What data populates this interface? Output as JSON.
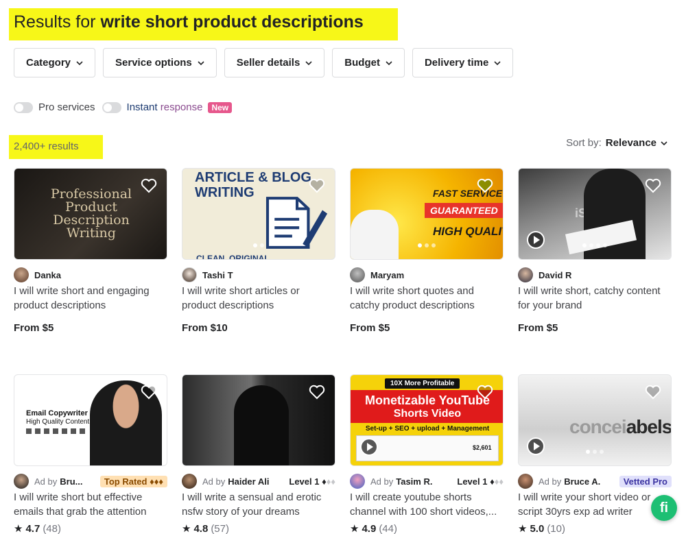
{
  "header": {
    "title_prefix": "Results for ",
    "title_query": "write short product descriptions"
  },
  "filters": [
    {
      "label": "Category"
    },
    {
      "label": "Service options"
    },
    {
      "label": "Seller details"
    },
    {
      "label": "Budget"
    },
    {
      "label": "Delivery time"
    }
  ],
  "toggles": {
    "pro_label": "Pro services",
    "instant_label_1": "Instant",
    "instant_label_2": "response",
    "new_badge": "New"
  },
  "results_count": "2,400+ results",
  "sort": {
    "label": "Sort by:",
    "value": "Relevance"
  },
  "cards": [
    {
      "seller": "Danka",
      "desc": "I will write short and engaging product descriptions",
      "price": "From $5",
      "thumb_text_1": "Professional Product Description Writing"
    },
    {
      "seller": "Tashi T",
      "desc": "I will write short articles or product descriptions",
      "price": "From $10",
      "thumb_text_1": "ARTICLE & BLOG WRITING",
      "thumb_text_2": "CLEAN, ORIGINAL"
    },
    {
      "seller": "Maryam",
      "desc": "I will write short quotes and catchy product descriptions",
      "price": "From $5",
      "thumb_text_1": "FAST SERVICE AN",
      "thumb_text_2": "GUARANTEED",
      "thumb_text_3": "HIGH QUALITY"
    },
    {
      "seller": "David R",
      "desc": "I will write short, catchy content for your brand",
      "price": "From $5",
      "thumb_text_1": "iStock"
    },
    {
      "ad_by": "Ad by",
      "seller": "Bru...",
      "badge": "Top Rated ♦♦♦",
      "desc": "I will write short but effective emails that grab the attention",
      "rating": "4.7",
      "reviews": "(48)",
      "thumb_text_1": "Email Copywriter",
      "thumb_text_2": "High Quality Content"
    },
    {
      "ad_by": "Ad by",
      "seller": "Haider Ali",
      "level": "Level 1 ♦",
      "desc": "I will write a sensual and erotic nsfw story of your dreams",
      "rating": "4.8",
      "reviews": "(57)"
    },
    {
      "ad_by": "Ad by",
      "seller": "Tasim R.",
      "level": "Level 1 ♦",
      "desc": "I will create youtube shorts channel with 100 short videos,...",
      "rating": "4.9",
      "reviews": "(44)",
      "thumb_text_1": "10X More Profitable",
      "thumb_text_2": "Monetizable YouTube",
      "thumb_text_3": "Shorts Video",
      "thumb_text_4": "Set-up + SEO + upload + Management",
      "thumb_text_5": "$2,601"
    },
    {
      "ad_by": "Ad by",
      "seller": "Bruce A.",
      "badge": "Vetted Pro",
      "desc": "I will write your short video or script 30yrs exp ad writer",
      "rating": "5.0",
      "reviews": "(10)",
      "thumb_text_1": "concei",
      "thumb_text_2": "abels"
    }
  ],
  "fab_label": "fi"
}
